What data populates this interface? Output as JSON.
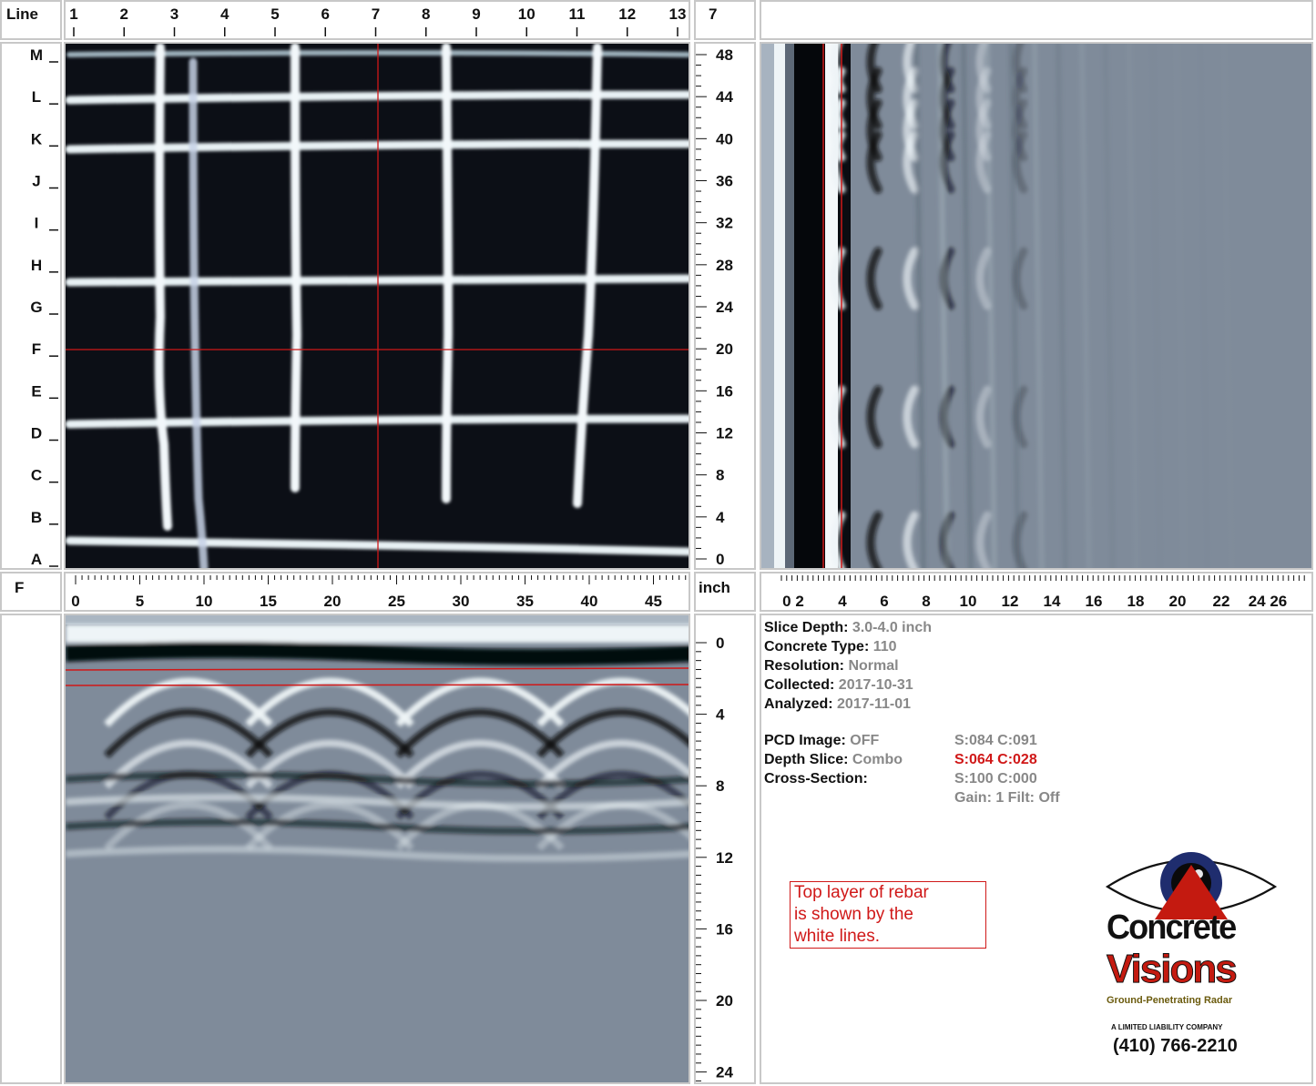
{
  "corner": {
    "top_left": "Line",
    "top_right_box": "7",
    "mid_left": "F",
    "mid_right": "inch"
  },
  "top_ruler_labels": [
    "1",
    "2",
    "3",
    "4",
    "5",
    "6",
    "7",
    "8",
    "9",
    "10",
    "11",
    "12",
    "13"
  ],
  "row_labels": [
    "M",
    "L",
    "K",
    "J",
    "I",
    "H",
    "G",
    "F",
    "E",
    "D",
    "C",
    "B",
    "A"
  ],
  "depth_ruler_right": [
    "48",
    "44",
    "40",
    "36",
    "32",
    "28",
    "24",
    "20",
    "16",
    "12",
    "8",
    "4",
    "0"
  ],
  "bottom_ruler_labels": [
    "0",
    "5",
    "10",
    "15",
    "20",
    "25",
    "30",
    "35",
    "40",
    "45"
  ],
  "depth_axis_labels": [
    "0 2",
    "4",
    "6",
    "8",
    "10",
    "12",
    "14",
    "16",
    "18",
    "20",
    "22",
    "24 26"
  ],
  "section_depth_labels": [
    "0",
    "4",
    "8",
    "12",
    "16",
    "20",
    "24"
  ],
  "info": {
    "slice_depth_label": "Slice Depth:",
    "slice_depth_value": "3.0-4.0 inch",
    "concrete_type_label": "Concrete Type:",
    "concrete_type_value": "110",
    "resolution_label": "Resolution:",
    "resolution_value": "Normal",
    "collected_label": "Collected:",
    "collected_value": "2017-10-31",
    "analyzed_label": "Analyzed:",
    "analyzed_value": "2017-11-01",
    "pcd_label": "PCD Image:",
    "pcd_value": "OFF",
    "pcd_sc": "S:084 C:091",
    "depth_slice_label": "Depth Slice:",
    "depth_slice_value": "Combo",
    "depth_slice_sc": "S:064 C:028",
    "cross_section_label": "Cross-Section:",
    "cross_section_sc": "S:100 C:000",
    "gain": "Gain: 1 Filt: Off"
  },
  "note": {
    "line1": "Top layer of rebar",
    "line2": "is shown by the",
    "line3": "white lines."
  },
  "logo": {
    "line1": "Concrete",
    "line2": "Visions",
    "tagline": "Ground-Penetrating Radar",
    "llc": "A LIMITED LIABILITY COMPANY",
    "phone": "(410) 766-2210"
  },
  "colors": {
    "accent_red": "#d01818",
    "logo_red": "#c41a10",
    "eye_blue": "#1f2d6e"
  }
}
